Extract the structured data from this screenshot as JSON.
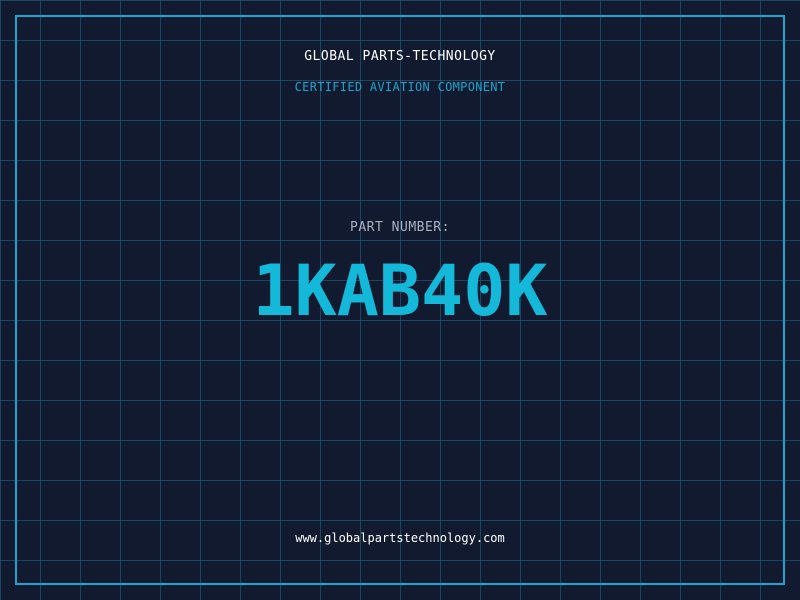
{
  "header": {
    "company": "GLOBAL PARTS-TECHNOLOGY",
    "tagline": "CERTIFIED AVIATION COMPONENT"
  },
  "part": {
    "label": "PART NUMBER:",
    "number": "1KAB40K"
  },
  "footer": {
    "website": "www.globalpartstechnology.com"
  },
  "colors": {
    "background": "#111a2e",
    "grid": "#1e6e96",
    "accent": "#1ca3cf",
    "part_number": "#14b8d8",
    "label": "#a9b3c2",
    "text": "#ffffff"
  }
}
